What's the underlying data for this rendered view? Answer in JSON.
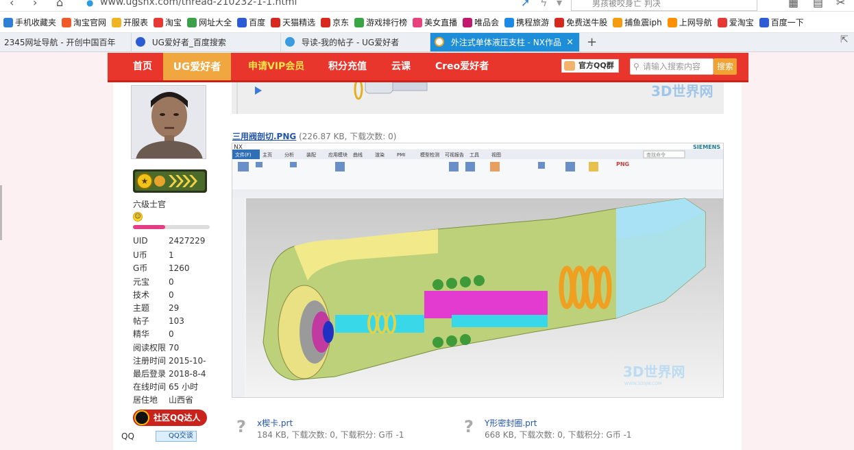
{
  "browser": {
    "url": "www.ugsnx.com/thread-210232-1-1.html",
    "search_hint": "男孩被咬身亡 判决",
    "bookmarks": [
      {
        "label": "手机收藏夹",
        "color": "#2f7fd6"
      },
      {
        "label": "淘宝官网",
        "color": "#f05a28"
      },
      {
        "label": "开服表",
        "color": "#f0b323"
      },
      {
        "label": "淘宝",
        "color": "#e53935"
      },
      {
        "label": "网址大全",
        "color": "#3aa14a"
      },
      {
        "label": "百度",
        "color": "#2d5bd3"
      },
      {
        "label": "天猫精选",
        "color": "#d7281e"
      },
      {
        "label": "京东",
        "color": "#d7281e"
      },
      {
        "label": "游戏排行榜",
        "color": "#39a545"
      },
      {
        "label": "美女直播",
        "color": "#e7427b"
      },
      {
        "label": "唯品会",
        "color": "#c2186e"
      },
      {
        "label": "携程旅游",
        "color": "#1e88e5"
      },
      {
        "label": "免费送牛股",
        "color": "#d7281e"
      },
      {
        "label": "捕鱼震iph",
        "color": "#f39c12"
      },
      {
        "label": "上网导航",
        "color": "#ff8f00"
      },
      {
        "label": "爱淘宝",
        "color": "#e53935"
      },
      {
        "label": "百度一下",
        "color": "#2d5bd3"
      }
    ],
    "tabs": [
      {
        "label": "2345网址导航 - 开创中国百年",
        "color": "#ffffff"
      },
      {
        "label": "UG爱好者_百度搜索",
        "color": "#2d5bd3"
      },
      {
        "label": "导读-我的帖子 - UG爱好者",
        "color": "#3b9be0"
      },
      {
        "label": "外注式单体液压支柱 - NX作品",
        "color": "#ffffff"
      }
    ],
    "tab_close": "×",
    "new_tab": "+"
  },
  "site_nav": {
    "items": [
      "首页",
      "UG爱好者",
      "申请VIP会员",
      "积分充值",
      "云课",
      "Creo爱好者"
    ],
    "qq_group": "官方QQ群",
    "search_placeholder": "请输入搜索内容",
    "search_button": "搜索"
  },
  "profile": {
    "rank": "六级士官",
    "progress": 0.42,
    "stats": [
      {
        "key": "UID",
        "value": "2427229"
      },
      {
        "key": "U币",
        "value": "1"
      },
      {
        "key": "G币",
        "value": "1260"
      },
      {
        "key": "元宝",
        "value": "0"
      },
      {
        "key": "技术",
        "value": "0"
      },
      {
        "key": "主题",
        "value": "29"
      },
      {
        "key": "帖子",
        "value": "103"
      },
      {
        "key": "精华",
        "value": "0"
      },
      {
        "key": "阅读权限",
        "value": "70"
      },
      {
        "key": "注册时间",
        "value": "2015-10-"
      },
      {
        "key": "最后登录",
        "value": "2018-8-4"
      },
      {
        "key": "在线时间",
        "value": "65 小时"
      },
      {
        "key": "居住地",
        "value": "山西省"
      }
    ],
    "qq_talent": "社区QQ达人",
    "qq_label": "QQ",
    "qq_chat": "QQ交谈"
  },
  "post": {
    "watermark": "3D世界网",
    "watermark_url": "WWW.3DSJW.COM",
    "attachment": {
      "name": "三用阀剖切.PNG",
      "meta": "(226.87 KB, 下载次数: 0)"
    },
    "nx_window": {
      "brand": "SIEMENS",
      "menu_tabs": [
        "文件(F)",
        "主页",
        "分析",
        "装配",
        "应用模块",
        "曲线",
        "渲染",
        "PMI",
        "模型检测",
        "可视报告",
        "工具",
        "视图"
      ],
      "search_hint": "查找命令"
    },
    "files": [
      {
        "name": "x楔卡.prt",
        "meta": "184 KB, 下载次数: 0, 下载积分: G币 -1"
      },
      {
        "name": "Y形密封圈.prt",
        "meta": "668 KB, 下载次数: 0, 下载积分: G币 -1"
      }
    ]
  }
}
